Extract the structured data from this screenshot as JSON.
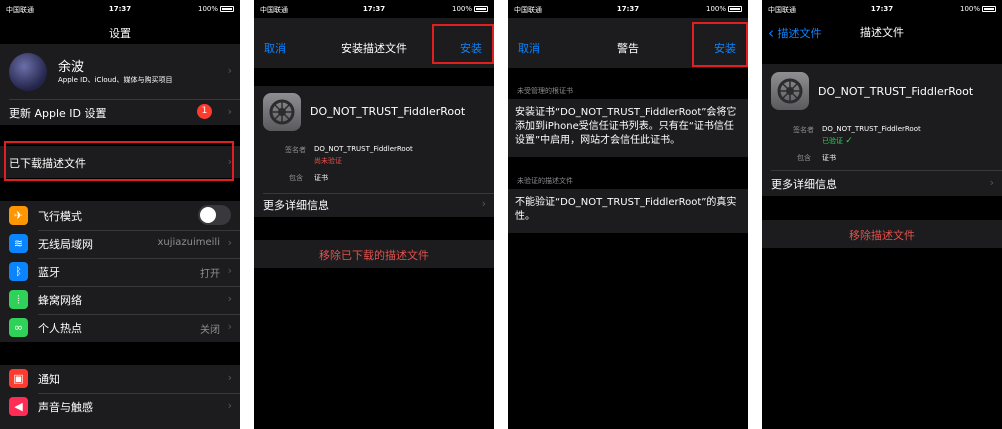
{
  "status": {
    "carrier": "中国联通",
    "time": "17:37",
    "battery": "100%"
  },
  "screen1": {
    "title": "设置",
    "profile": {
      "name": "余波",
      "subtitle": "Apple ID、iCloud、媒体与购买项目"
    },
    "update_apple_id": "更新 Apple ID 设置",
    "update_badge": "1",
    "downloaded_profile": "已下载描述文件",
    "airplane": "飞行模式",
    "wifi": "无线局域网",
    "wifi_value": "xujiazuimeili",
    "bluetooth": "蓝牙",
    "bluetooth_value": "打开",
    "cellular": "蜂窝网络",
    "hotspot": "个人热点",
    "hotspot_value": "关闭",
    "notifications": "通知",
    "sounds": "声音与触感"
  },
  "screen2": {
    "cancel": "取消",
    "title": "安装描述文件",
    "install": "安装",
    "profile_name": "DO_NOT_TRUST_FiddlerRoot",
    "signed_by_key": "签名者",
    "signed_by_value": "DO_NOT_TRUST_FiddlerRoot",
    "unverified": "尚未验证",
    "contains_key": "包含",
    "contains_value": "证书",
    "more_details": "更多详细信息",
    "remove": "移除已下载的描述文件"
  },
  "screen3": {
    "cancel": "取消",
    "title": "警告",
    "install": "安装",
    "section1": "未受管理的根证书",
    "warning1": "安装证书“DO_NOT_TRUST_FiddlerRoot”会将它添加到iPhone受信任证书列表。只有在“证书信任设置”中启用，网站才会信任此证书。",
    "section2": "未验证的描述文件",
    "warning2": "不能验证“DO_NOT_TRUST_FiddlerRoot”的真实性。"
  },
  "screen4": {
    "back": "描述文件",
    "title": "描述文件",
    "profile_name": "DO_NOT_TRUST_FiddlerRoot",
    "signed_by_key": "签名者",
    "signed_by_value": "DO_NOT_TRUST_FiddlerRoot",
    "verified": "已验证",
    "contains_key": "包含",
    "contains_value": "证书",
    "more_details": "更多详细信息",
    "remove": "移除描述文件"
  },
  "colors": {
    "accent": "#0a84ff",
    "highlight": "#e02020",
    "destructive": "#e0524d",
    "verified": "#30d158"
  }
}
